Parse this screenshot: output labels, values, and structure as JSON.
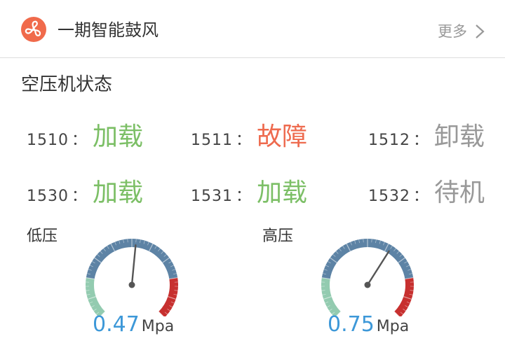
{
  "header": {
    "title": "一期智能鼓风",
    "more_label": "更多",
    "icon": "fan-icon",
    "icon_color": "#f06a4b"
  },
  "section": {
    "title": "空压机状态"
  },
  "colors": {
    "load": "#7cbf66",
    "fault": "#ee6a4e",
    "idle": "#999999",
    "reading": "#3d98d8",
    "gauge_green": "#93cbb0",
    "gauge_blue": "#5d83a5",
    "gauge_red": "#c7302f"
  },
  "compressors": [
    {
      "code": "1510",
      "sep": "：",
      "status": "加载",
      "state": "load"
    },
    {
      "code": "1511",
      "sep": "：",
      "status": "故障",
      "state": "fault"
    },
    {
      "code": "1512",
      "sep": "：",
      "status": "卸载",
      "state": "idle"
    },
    {
      "code": "1530",
      "sep": "：",
      "status": "加载",
      "state": "load"
    },
    {
      "code": "1531",
      "sep": "：",
      "status": "加载",
      "state": "load"
    },
    {
      "code": "1532",
      "sep": "：",
      "status": "待机",
      "state": "idle"
    }
  ],
  "gauges": [
    {
      "label": "低压",
      "value": "0.47",
      "unit": "Mpa",
      "fraction": 0.52
    },
    {
      "label": "高压",
      "value": "0.75",
      "unit": "Mpa",
      "fraction": 0.62
    }
  ]
}
